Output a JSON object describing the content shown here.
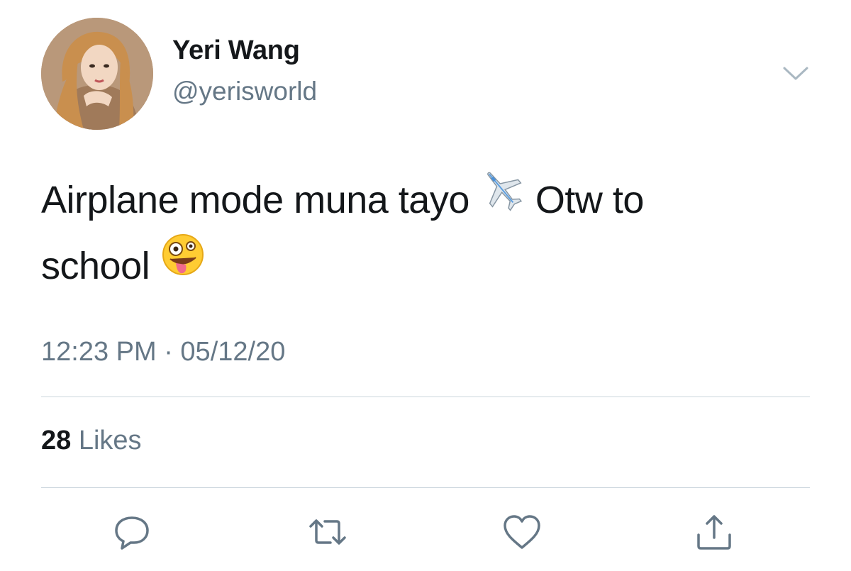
{
  "author": {
    "display_name": "Yeri Wang",
    "handle": "@yerisworld"
  },
  "tweet": {
    "text_line1_a": "Airplane mode muna tayo",
    "emoji1": "airplane-emoji",
    "text_line1_b": "Otw to",
    "text_line2": "school",
    "emoji2": "zany-face-emoji",
    "timestamp": "12:23 PM · 05/12/20"
  },
  "stats": {
    "likes_count": "28",
    "likes_label": "Likes"
  },
  "actions": {
    "reply_icon": "reply-icon",
    "retweet_icon": "retweet-icon",
    "like_icon": "heart-icon",
    "share_icon": "share-icon"
  },
  "colors": {
    "text_primary": "#14171a",
    "text_secondary": "#657786",
    "divider": "#ccd6dd"
  }
}
